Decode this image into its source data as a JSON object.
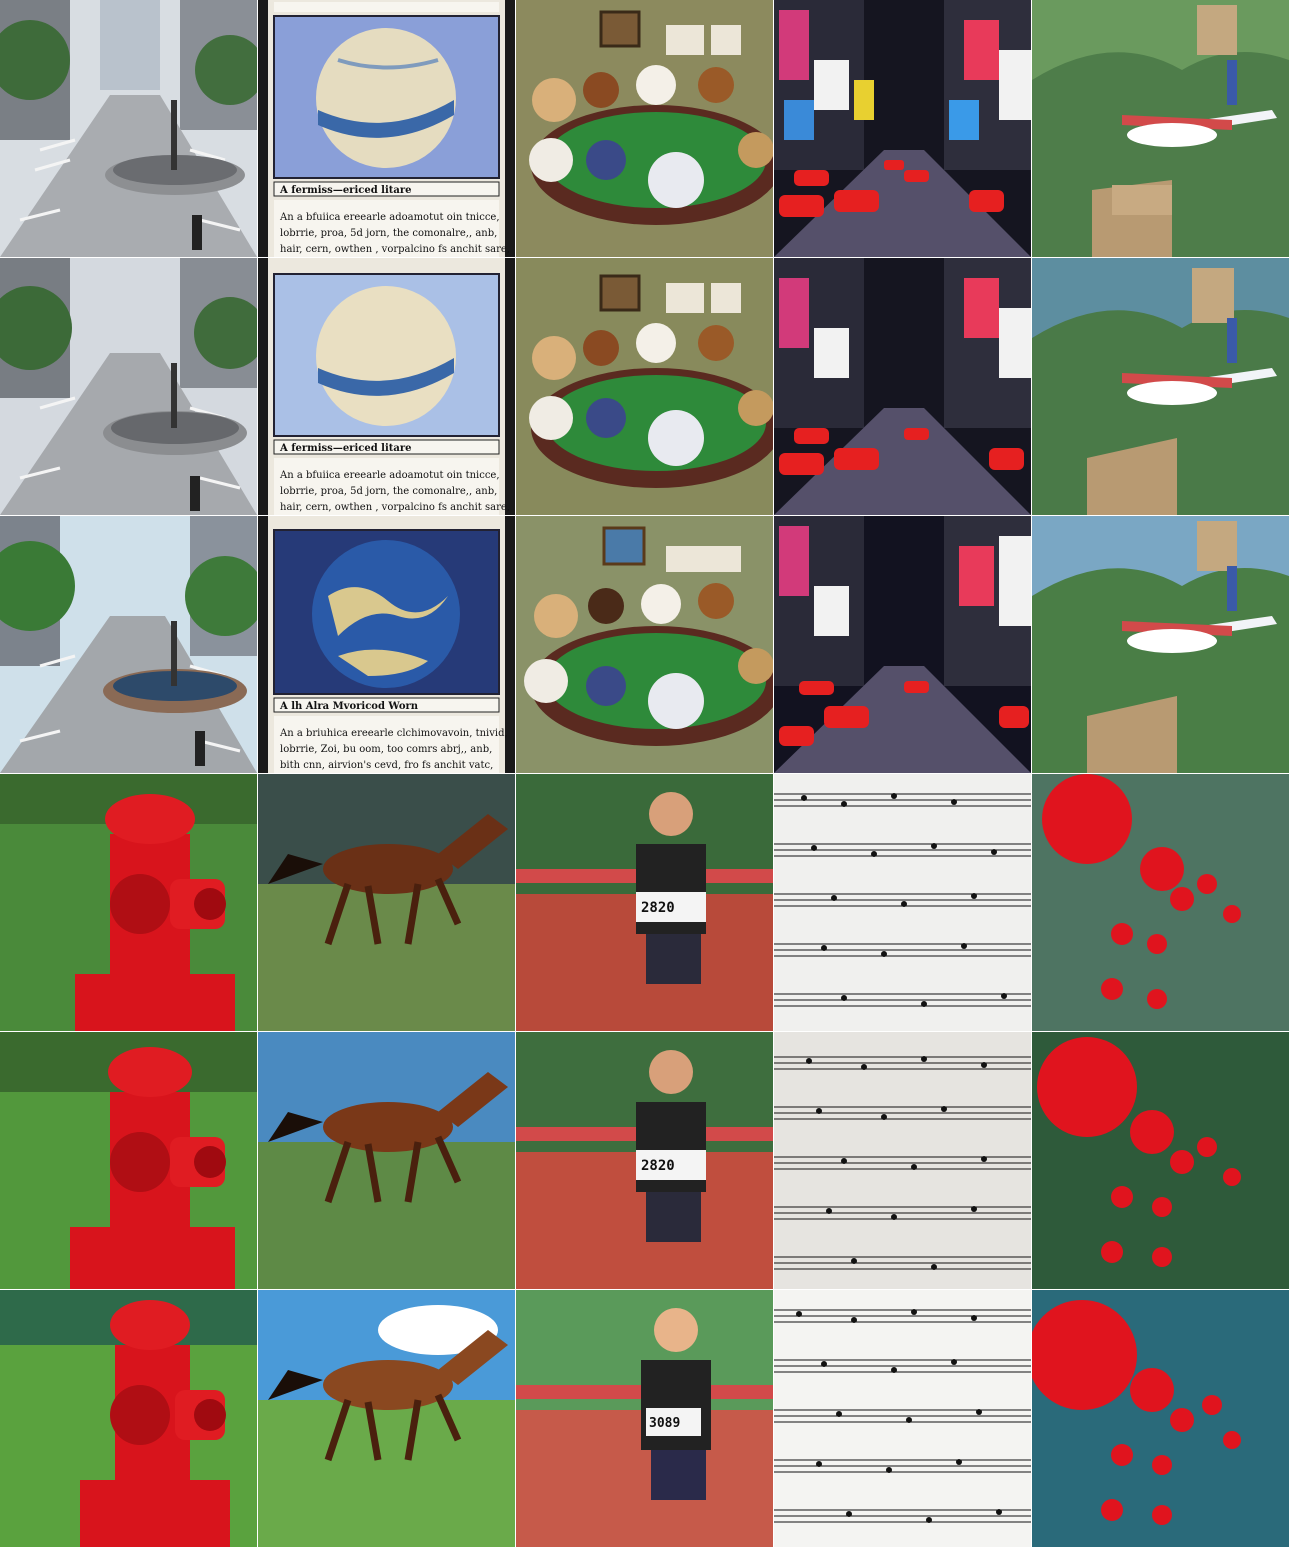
{
  "grid": {
    "rows": 6,
    "columns": 5,
    "subjects": [
      "city-street-roundabout",
      "trading-card-globe",
      "dogs-playing-poker",
      "times-square-traffic",
      "airplane-great-wall",
      "red-fire-hydrant",
      "galloping-horse",
      "marathon-runner",
      "sheet-music",
      "red-ornaments-trees"
    ]
  },
  "cards": [
    {
      "title": "A fermiss—ericed litare",
      "lines": [
        "An a bfuiica ereearle adoamotut oin tnicce,",
        "lobrrie, proa, 5d jorn, the comonalre,, anb,",
        "hair, cern, owthen , vorpalcino fs anchit sare,"
      ]
    },
    {
      "title": "A fermiss—ericed litare",
      "lines": [
        "An a bfuiica ereearle adoamotut oin tnicce,",
        "lobrrie, proa, 5d jorn, the comonalre,, anb,",
        "hair, cern, owthen , vorpalcino fs anchit sare,"
      ]
    },
    {
      "title": "A lh  Alra Mvoricod Worn",
      "lines": [
        "An a briuhica ereearle clchimovavoin, tnivid,",
        "lobrrie, Zoi, bu oom, too comrs abrj,, anb,",
        "bith cnn, airvion's cevd, fro fs anchit vatc,"
      ]
    }
  ],
  "bibs": [
    "2820",
    "2820",
    "3089"
  ],
  "colors": {
    "hydrant": "#d8141c",
    "felt": "#2e8a3a",
    "ornament": "#e0141e",
    "grass": "#4a8a3a",
    "taxi": "#e62020"
  }
}
